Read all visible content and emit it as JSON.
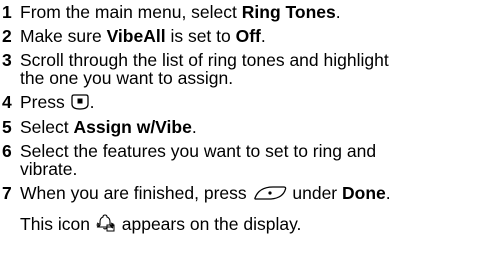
{
  "steps": [
    {
      "num": "1",
      "pre": "From the main menu, select ",
      "bold": "Ring Tones",
      "post": "."
    },
    {
      "num": "2",
      "pre": "Make sure ",
      "bold": "VibeAll",
      "mid": " is set to ",
      "bold2": "Off",
      "post": "."
    },
    {
      "num": "3",
      "line1": "Scroll through the list of ring tones and highlight",
      "line2": "the one you want to assign."
    },
    {
      "num": "4",
      "pre": "Press ",
      "icon": "menu-key-icon",
      "post": "."
    },
    {
      "num": "5",
      "pre": "Select ",
      "bold": "Assign w/Vibe",
      "post": "."
    },
    {
      "num": "6",
      "line1": "Select the features you want to set to ring and",
      "line2": "vibrate."
    },
    {
      "num": "7",
      "pre": "When you are finished, press ",
      "icon": "left-softkey-icon",
      "mid": " under ",
      "bold": "Done",
      "post": "."
    }
  ],
  "note": {
    "pre": "This icon ",
    "icon": "ring-and-vibrate-icon",
    "post": " appears on the display."
  }
}
